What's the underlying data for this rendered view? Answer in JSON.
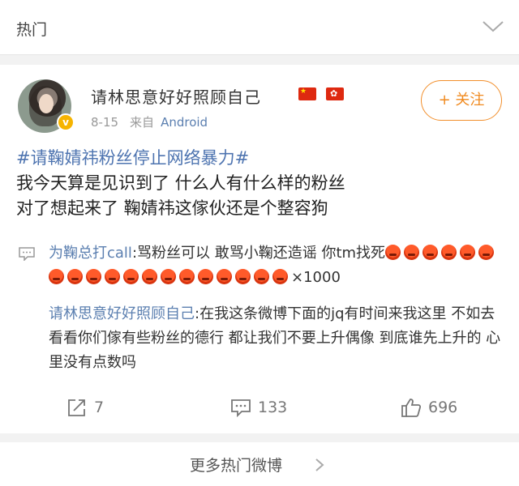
{
  "header": {
    "title": "热门"
  },
  "post": {
    "username": "请林思意好好照顾自己",
    "verified_badge": "v",
    "date": "8-15",
    "from_label": "来自",
    "source": "Android",
    "follow_label": "+ 关注",
    "hashtag": "#请鞠婧祎粉丝停止网络暴力#",
    "body_lines": [
      "我今天算是见识到了 什么人有什么样的粉丝",
      "对了想起来了  鞠婧祎这傢伙还是个整容狗"
    ]
  },
  "comments": [
    {
      "author": "为鞠总打call",
      "text_before": ":骂粉丝可以 敢骂小鞠还造谣 你tm找死",
      "emoji_name": "angry-face-emoji",
      "emoji_count": 19,
      "suffix": "×1000"
    },
    {
      "author": "请林思意好好照顾自己",
      "text": ":在我这条微博下面的jq有时间来我这里 不如去看看你们傢有些粉丝的德行 都让我们不要上升偶像  到底谁先上升的 心里没有点数吗"
    }
  ],
  "actions": {
    "repost_count": "7",
    "comment_count": "133",
    "like_count": "696"
  },
  "footer": {
    "more_label": "更多热门微博"
  },
  "colors": {
    "accent_orange": "#f08a1f",
    "link_blue": "#5b7fb0",
    "hashtag_blue": "#4e74b0",
    "badge_yellow": "#f6b400"
  }
}
